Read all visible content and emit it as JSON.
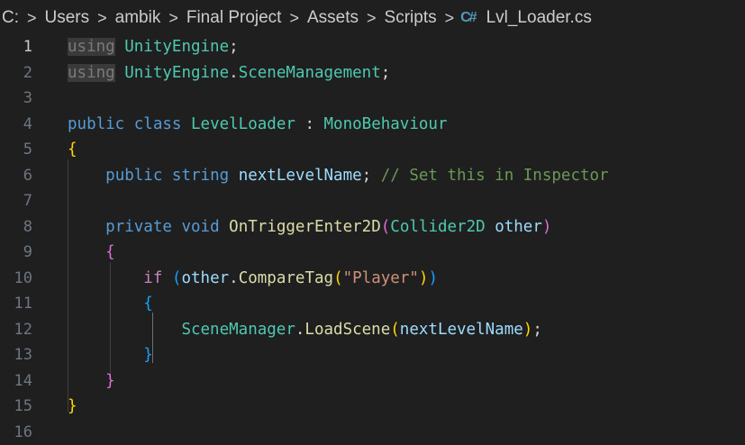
{
  "breadcrumb": {
    "segments": [
      "C:",
      "Users",
      "ambik",
      "Final Project",
      "Assets",
      "Scripts"
    ],
    "file_icon": "C#",
    "file_name": "Lvl_Loader.cs",
    "separator": ">"
  },
  "editor": {
    "active_line": 1,
    "line_numbers": [
      "1",
      "2",
      "3",
      "4",
      "5",
      "6",
      "7",
      "8",
      "9",
      "10",
      "11",
      "12",
      "13",
      "14",
      "15",
      "16"
    ],
    "colors": {
      "background": "#1f1f1f",
      "keyword": "#569cd6",
      "control_keyword": "#c586c0",
      "type": "#4ec9b0",
      "identifier": "#9cdcfe",
      "function": "#dcdcaa",
      "string": "#ce9178",
      "comment": "#6a9955",
      "bracket_level1": "#ffd700",
      "bracket_level2": "#da70d6",
      "bracket_level3": "#179fff"
    },
    "lines": [
      [
        [
          "kw dim",
          "using"
        ],
        [
          "pn",
          " "
        ],
        [
          "ty",
          "UnityEngine"
        ],
        [
          "pn",
          ";"
        ]
      ],
      [
        [
          "kw dim",
          "using"
        ],
        [
          "pn",
          " "
        ],
        [
          "ty",
          "UnityEngine"
        ],
        [
          "pn",
          "."
        ],
        [
          "ty",
          "SceneManagement"
        ],
        [
          "pn",
          ";"
        ]
      ],
      [],
      [
        [
          "kw",
          "public"
        ],
        [
          "pn",
          " "
        ],
        [
          "kw",
          "class"
        ],
        [
          "pn",
          " "
        ],
        [
          "ty",
          "LevelLoader"
        ],
        [
          "pn",
          " : "
        ],
        [
          "ty",
          "MonoBehaviour"
        ]
      ],
      [
        [
          "b1",
          "{"
        ]
      ],
      [
        [
          "pn",
          "    "
        ],
        [
          "kw",
          "public"
        ],
        [
          "pn",
          " "
        ],
        [
          "kw",
          "string"
        ],
        [
          "pn",
          " "
        ],
        [
          "id",
          "nextLevelName"
        ],
        [
          "pn",
          "; "
        ],
        [
          "cm",
          "// Set this in Inspector"
        ]
      ],
      [],
      [
        [
          "pn",
          "    "
        ],
        [
          "kw",
          "private"
        ],
        [
          "pn",
          " "
        ],
        [
          "kw",
          "void"
        ],
        [
          "pn",
          " "
        ],
        [
          "fn",
          "OnTriggerEnter2D"
        ],
        [
          "b2",
          "("
        ],
        [
          "ty",
          "Collider2D"
        ],
        [
          "pn",
          " "
        ],
        [
          "id",
          "other"
        ],
        [
          "b2",
          ")"
        ]
      ],
      [
        [
          "pn",
          "    "
        ],
        [
          "b2",
          "{"
        ]
      ],
      [
        [
          "pn",
          "        "
        ],
        [
          "kw2",
          "if"
        ],
        [
          "pn",
          " "
        ],
        [
          "b3",
          "("
        ],
        [
          "id",
          "other"
        ],
        [
          "pn",
          "."
        ],
        [
          "fn",
          "CompareTag"
        ],
        [
          "b1",
          "("
        ],
        [
          "str",
          "\"Player\""
        ],
        [
          "b1",
          ")"
        ],
        [
          "b3",
          ")"
        ]
      ],
      [
        [
          "pn",
          "        "
        ],
        [
          "b3",
          "{"
        ]
      ],
      [
        [
          "pn",
          "            "
        ],
        [
          "ty",
          "SceneManager"
        ],
        [
          "pn",
          "."
        ],
        [
          "fn",
          "LoadScene"
        ],
        [
          "b1",
          "("
        ],
        [
          "id",
          "nextLevelName"
        ],
        [
          "b1",
          ")"
        ],
        [
          "pn",
          ";"
        ]
      ],
      [
        [
          "pn",
          "        "
        ],
        [
          "b3",
          "}"
        ]
      ],
      [
        [
          "pn",
          "    "
        ],
        [
          "b2",
          "}"
        ]
      ],
      [
        [
          "b1",
          "}"
        ]
      ],
      []
    ]
  }
}
